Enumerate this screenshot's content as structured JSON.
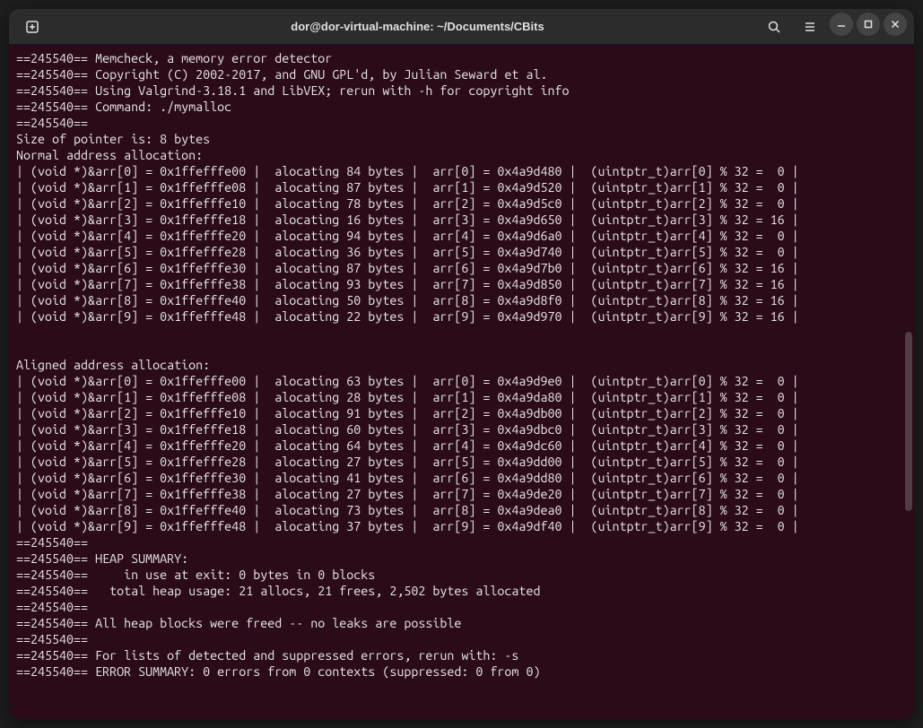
{
  "window": {
    "title": "dor@dor-virtual-machine: ~/Documents/CBits"
  },
  "terminal": {
    "pid": "245540",
    "header": [
      "==245540== Memcheck, a memory error detector",
      "==245540== Copyright (C) 2002-2017, and GNU GPL'd, by Julian Seward et al.",
      "==245540== Using Valgrind-3.18.1 and LibVEX; rerun with -h for copyright info",
      "==245540== Command: ./mymalloc",
      "==245540== "
    ],
    "ptr_size": "Size of pointer is: 8 bytes",
    "section1_title": "Normal address allocation:",
    "normal_rows": [
      {
        "idx": 0,
        "stack": "0x1ffefffe00",
        "bytes": 84,
        "heap": "0x4a9d480",
        "mod": 0
      },
      {
        "idx": 1,
        "stack": "0x1ffefffe08",
        "bytes": 87,
        "heap": "0x4a9d520",
        "mod": 0
      },
      {
        "idx": 2,
        "stack": "0x1ffefffe10",
        "bytes": 78,
        "heap": "0x4a9d5c0",
        "mod": 0
      },
      {
        "idx": 3,
        "stack": "0x1ffefffe18",
        "bytes": 16,
        "heap": "0x4a9d650",
        "mod": 16
      },
      {
        "idx": 4,
        "stack": "0x1ffefffe20",
        "bytes": 94,
        "heap": "0x4a9d6a0",
        "mod": 0
      },
      {
        "idx": 5,
        "stack": "0x1ffefffe28",
        "bytes": 36,
        "heap": "0x4a9d740",
        "mod": 0
      },
      {
        "idx": 6,
        "stack": "0x1ffefffe30",
        "bytes": 87,
        "heap": "0x4a9d7b0",
        "mod": 16
      },
      {
        "idx": 7,
        "stack": "0x1ffefffe38",
        "bytes": 93,
        "heap": "0x4a9d850",
        "mod": 16
      },
      {
        "idx": 8,
        "stack": "0x1ffefffe40",
        "bytes": 50,
        "heap": "0x4a9d8f0",
        "mod": 16
      },
      {
        "idx": 9,
        "stack": "0x1ffefffe48",
        "bytes": 22,
        "heap": "0x4a9d970",
        "mod": 16
      }
    ],
    "section2_title": "Aligned address allocation:",
    "aligned_rows": [
      {
        "idx": 0,
        "stack": "0x1ffefffe00",
        "bytes": 63,
        "heap": "0x4a9d9e0",
        "mod": 0
      },
      {
        "idx": 1,
        "stack": "0x1ffefffe08",
        "bytes": 28,
        "heap": "0x4a9da80",
        "mod": 0
      },
      {
        "idx": 2,
        "stack": "0x1ffefffe10",
        "bytes": 91,
        "heap": "0x4a9db00",
        "mod": 0
      },
      {
        "idx": 3,
        "stack": "0x1ffefffe18",
        "bytes": 60,
        "heap": "0x4a9dbc0",
        "mod": 0
      },
      {
        "idx": 4,
        "stack": "0x1ffefffe20",
        "bytes": 64,
        "heap": "0x4a9dc60",
        "mod": 0
      },
      {
        "idx": 5,
        "stack": "0x1ffefffe28",
        "bytes": 27,
        "heap": "0x4a9dd00",
        "mod": 0
      },
      {
        "idx": 6,
        "stack": "0x1ffefffe30",
        "bytes": 41,
        "heap": "0x4a9dd80",
        "mod": 0
      },
      {
        "idx": 7,
        "stack": "0x1ffefffe38",
        "bytes": 27,
        "heap": "0x4a9de20",
        "mod": 0
      },
      {
        "idx": 8,
        "stack": "0x1ffefffe40",
        "bytes": 73,
        "heap": "0x4a9dea0",
        "mod": 0
      },
      {
        "idx": 9,
        "stack": "0x1ffefffe48",
        "bytes": 37,
        "heap": "0x4a9df40",
        "mod": 0
      }
    ],
    "footer": [
      "==245540== ",
      "==245540== HEAP SUMMARY:",
      "==245540==     in use at exit: 0 bytes in 0 blocks",
      "==245540==   total heap usage: 21 allocs, 21 frees, 2,502 bytes allocated",
      "==245540== ",
      "==245540== All heap blocks were freed -- no leaks are possible",
      "==245540== ",
      "==245540== For lists of detected and suppressed errors, rerun with: -s",
      "==245540== ERROR SUMMARY: 0 errors from 0 contexts (suppressed: 0 from 0)"
    ]
  }
}
